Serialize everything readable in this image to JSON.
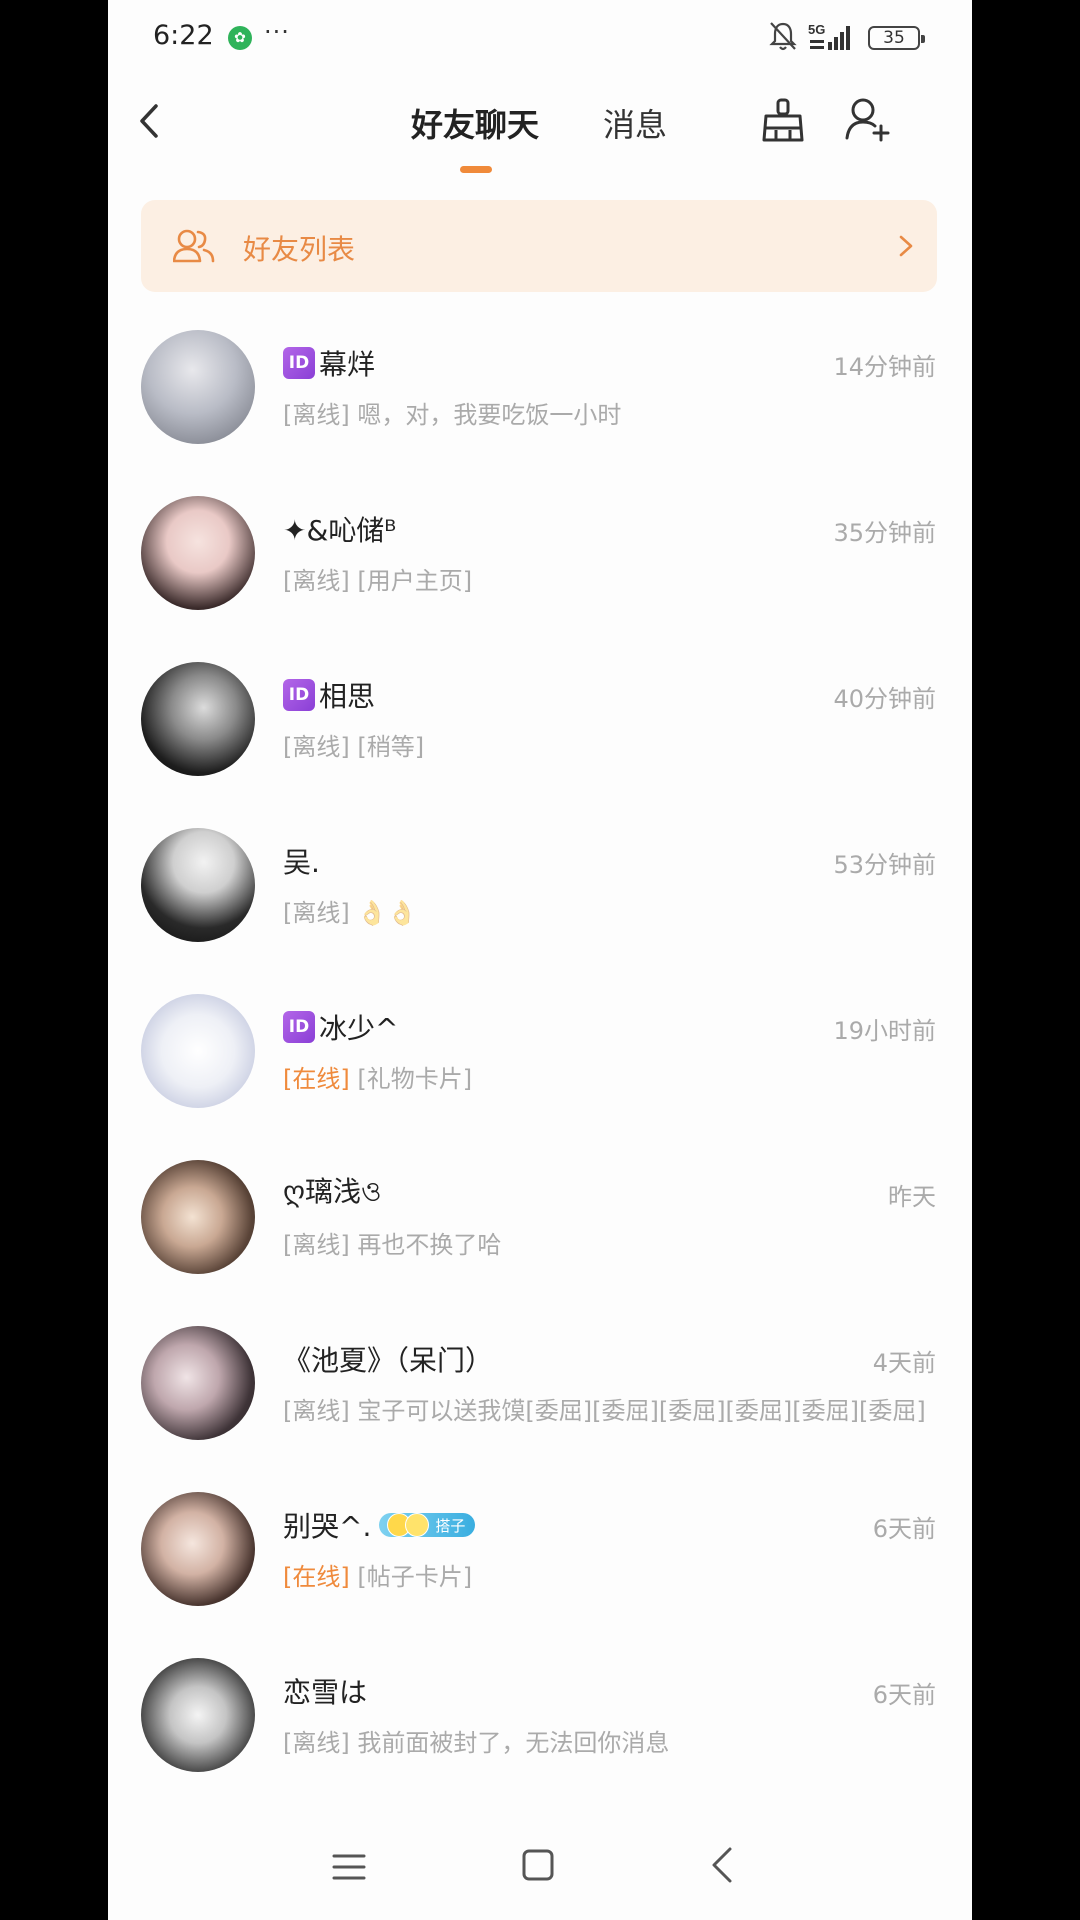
{
  "status_bar": {
    "time": "6:22",
    "network": "5G",
    "battery": "35"
  },
  "header": {
    "tabs": [
      "好友聊天",
      "消息"
    ],
    "active_tab": 0
  },
  "banner": {
    "label": "好友列表"
  },
  "chats": [
    {
      "name": "幕烊",
      "id_badge": "ID",
      "time": "14分钟前",
      "status": "[离线]",
      "message": "嗯，对，我要吃饭一小时"
    },
    {
      "name": "✦&吣储ᴮ",
      "time": "35分钟前",
      "status": "[离线]",
      "message": "[用户主页]"
    },
    {
      "name": "相思",
      "id_badge": "ID",
      "time": "40分钟前",
      "status": "[离线]",
      "message": "[稍等]"
    },
    {
      "name": "吴.",
      "time": "53分钟前",
      "status": "[离线]",
      "message": "👌👌"
    },
    {
      "name": "冰少^",
      "id_badge": "ID",
      "time": "19小时前",
      "status": "[在线]",
      "message": "[礼物卡片]"
    },
    {
      "name": "ღ璃浅ও",
      "time": "昨天",
      "status": "[离线]",
      "message": "再也不换了哈"
    },
    {
      "name": "《池夏》（呆门）",
      "time": "4天前",
      "status": "[离线]",
      "message": "宝子可以送我馍[委屈][委屈][委屈][委屈][委屈][委屈]"
    },
    {
      "name": "别哭^.",
      "tag": "搭子",
      "time": "6天前",
      "status": "[在线]",
      "message": "[帖子卡片]"
    },
    {
      "name": "恋雪は",
      "time": "6天前",
      "status": "[离线]",
      "message": "我前面被封了，无法回你消息"
    }
  ],
  "colors": {
    "accent": "#f08a3a",
    "banner_bg": "#fcefe3",
    "id_badge": "#9b4fe0",
    "online": "#ef8a3c",
    "muted": "#aaaaaa"
  }
}
